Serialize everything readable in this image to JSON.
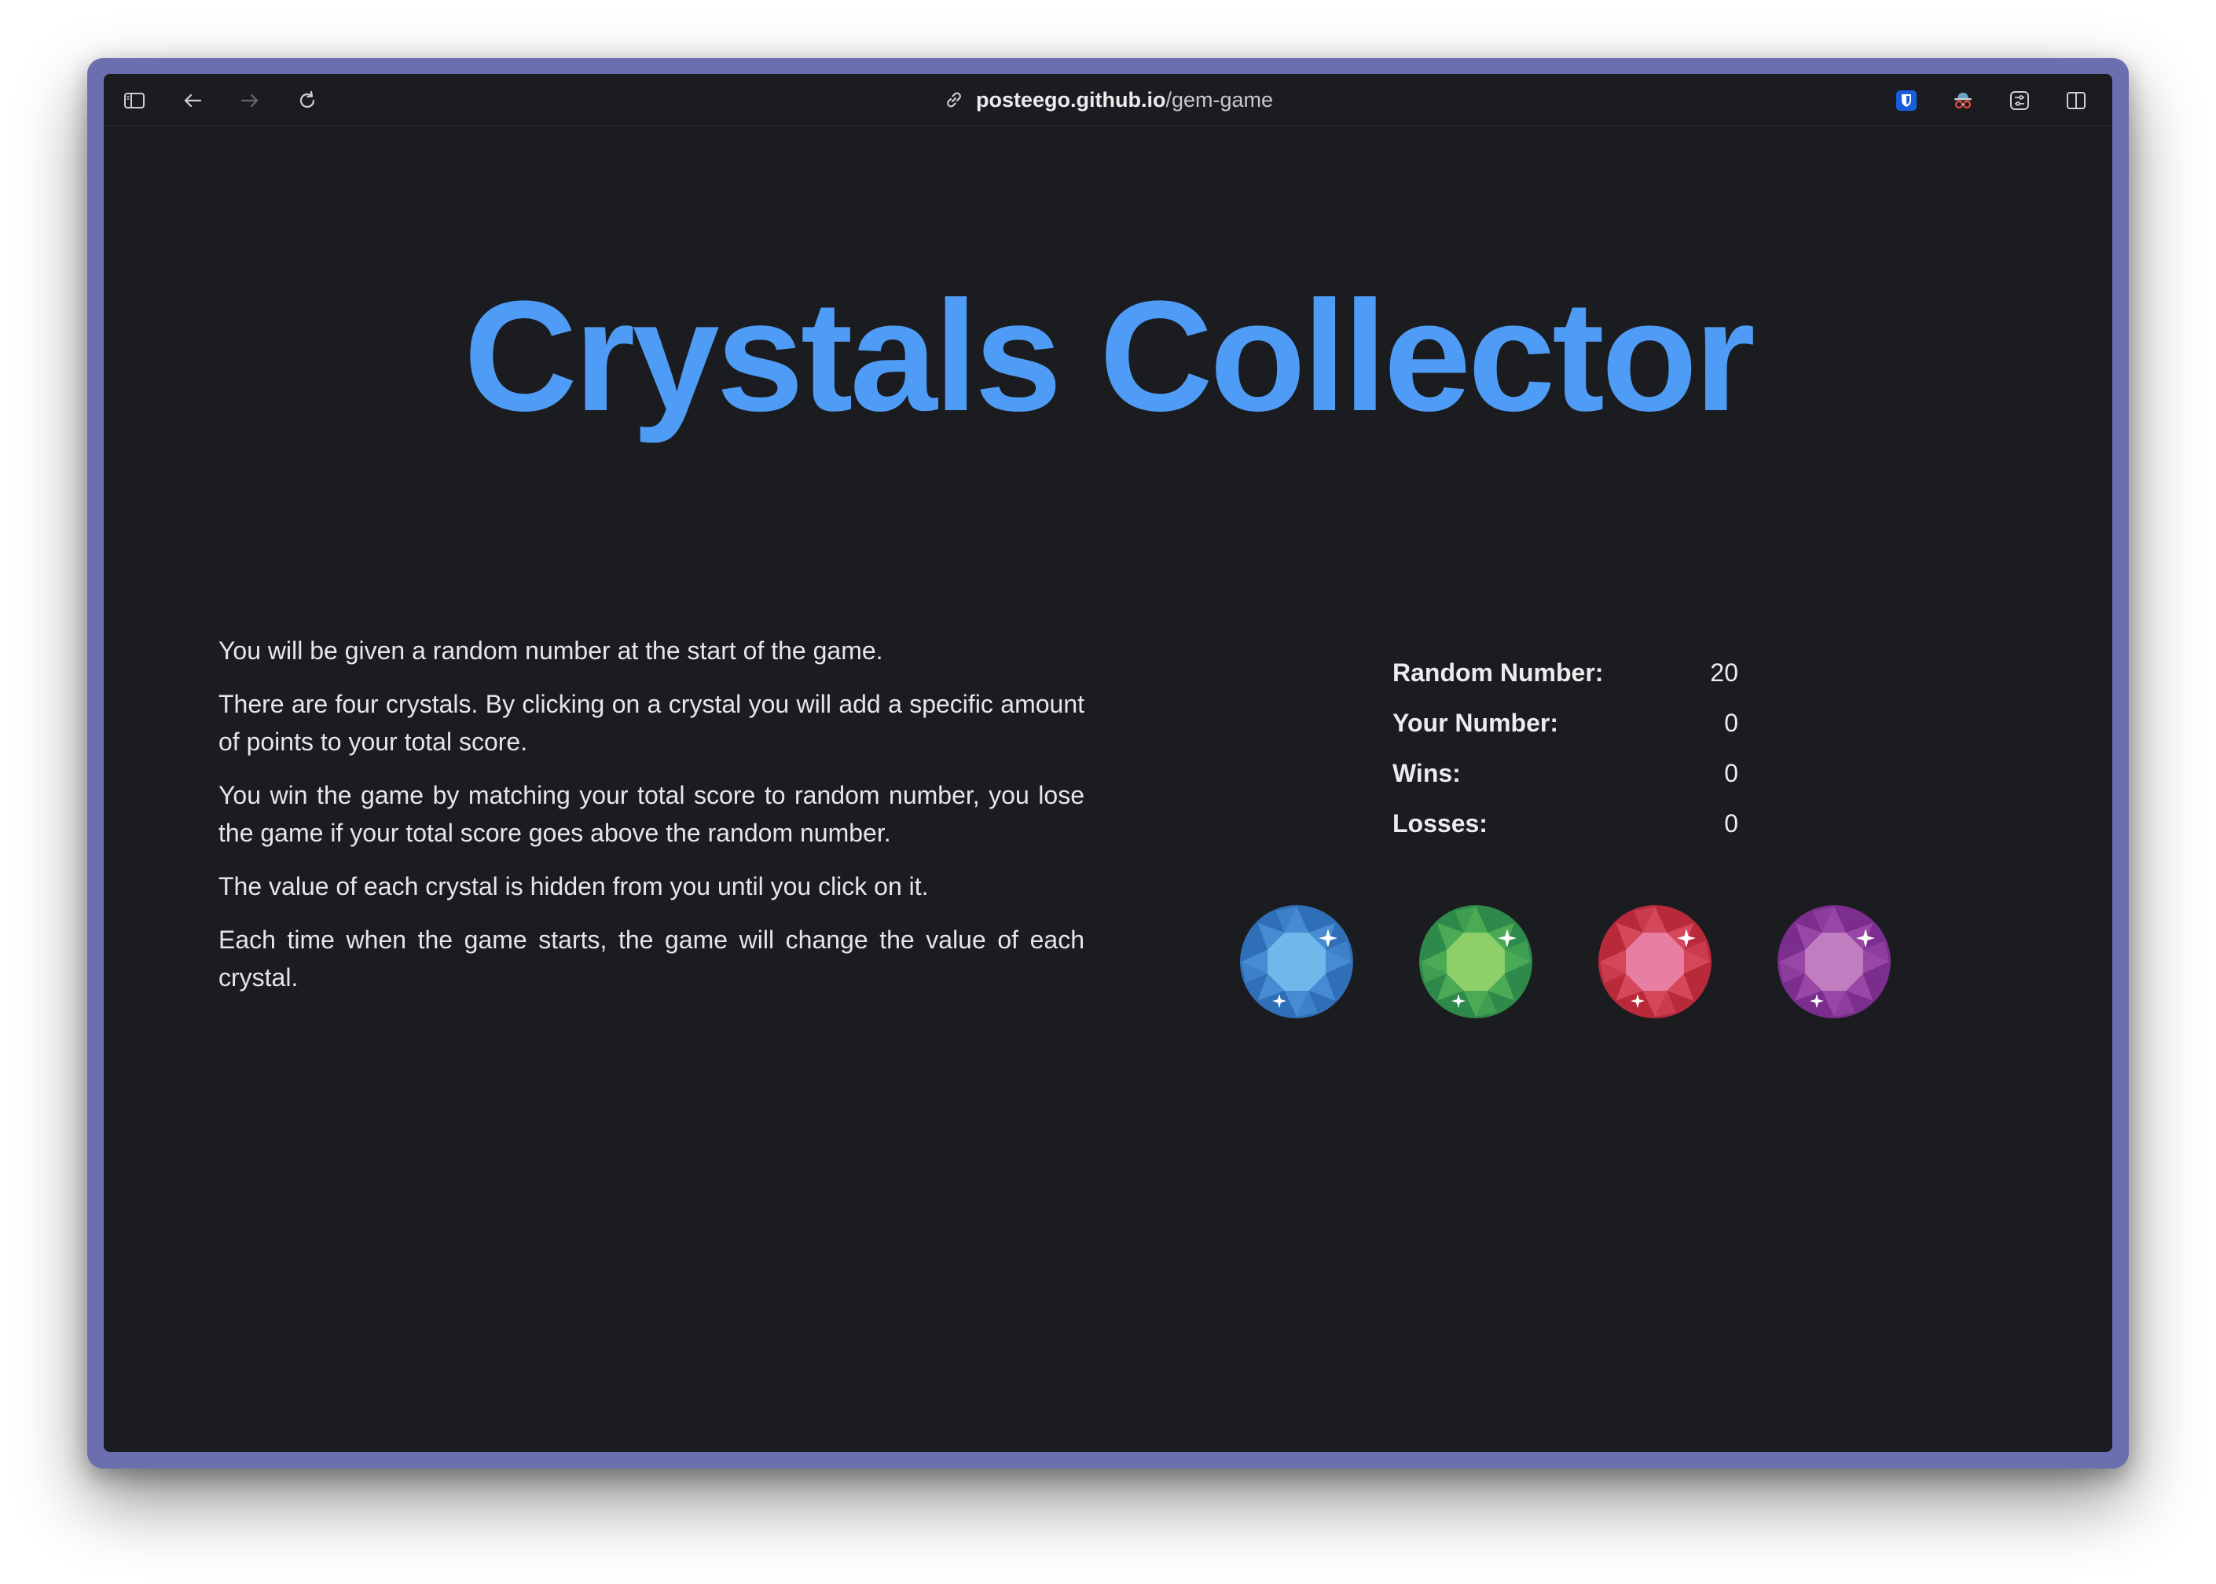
{
  "browser": {
    "url_host": "posteego.github.io",
    "url_path": "/gem-game",
    "icons": [
      "sidebar-icon",
      "back-arrow-icon",
      "forward-arrow-icon",
      "reload-icon",
      "link-icon",
      "bitwarden-shield-icon",
      "incognito-glasses-icon",
      "extension-settings-icon",
      "split-view-icon"
    ]
  },
  "page": {
    "title": "Crystals Collector",
    "instructions": [
      "You will be given a random number at the start of the game.",
      "There are four crystals. By clicking on a crystal you will add a specific amount of points to your total score.",
      "You win the game by matching your total score to random number, you lose the game if your total score goes above the random number.",
      "The value of each crystal is hidden from you until you click on it.",
      "Each time when the game starts, the game will change the value of each crystal."
    ],
    "stats": {
      "random_label": "Random Number:",
      "random_value": "20",
      "your_label": "Your Number:",
      "your_value": "0",
      "wins_label": "Wins:",
      "wins_value": "0",
      "losses_label": "Losses:",
      "losses_value": "0"
    },
    "crystals": [
      {
        "name": "blue-crystal",
        "outer": "#2f6fb8",
        "inner": "#6fb9ea",
        "mid": "#4a8fd6"
      },
      {
        "name": "green-crystal",
        "outer": "#2e8a4a",
        "inner": "#8fcf6a",
        "mid": "#4fae57"
      },
      {
        "name": "red-crystal",
        "outer": "#b8293a",
        "inner": "#e77fa3",
        "mid": "#d84a5e"
      },
      {
        "name": "purple-crystal",
        "outer": "#7b2e8e",
        "inner": "#c07dc0",
        "mid": "#9c4aa8"
      }
    ]
  },
  "colors": {
    "title": "#4f9cf6",
    "window_frame": "#6b6fb0",
    "page_bg": "#1b1c1f"
  }
}
